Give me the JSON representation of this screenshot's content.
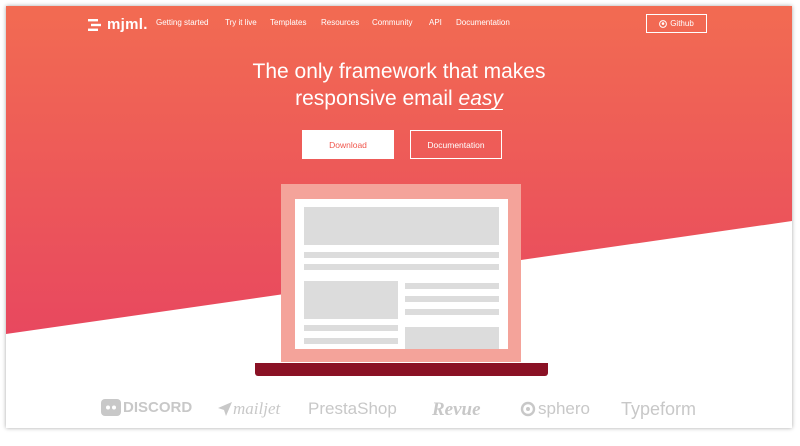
{
  "nav": {
    "logo_text": "mjml.",
    "links": [
      "Getting started",
      "Try it live",
      "Templates",
      "Resources",
      "Community",
      "API",
      "Documentation"
    ],
    "github_label": "Github"
  },
  "hero": {
    "line1": "The only framework that makes",
    "line2_prefix": "responsive email ",
    "line2_emphasis": "easy",
    "download_label": "Download",
    "documentation_label": "Documentation"
  },
  "brands": [
    "DISCORD",
    "mailjet",
    "PrestaShop",
    "Revue",
    "sphero",
    "Typeform"
  ],
  "colors": {
    "gradient_top": "#f26b52",
    "gradient_bottom": "#e8485f",
    "laptop_body": "#f4a39a",
    "laptop_base": "#8a1125",
    "placeholder_block": "#dcdcdc",
    "brand_logo": "#c8c8c8"
  },
  "icons": [
    "mjml-logo-icon",
    "github-icon",
    "discord-icon",
    "mailjet-icon",
    "sphero-icon"
  ]
}
